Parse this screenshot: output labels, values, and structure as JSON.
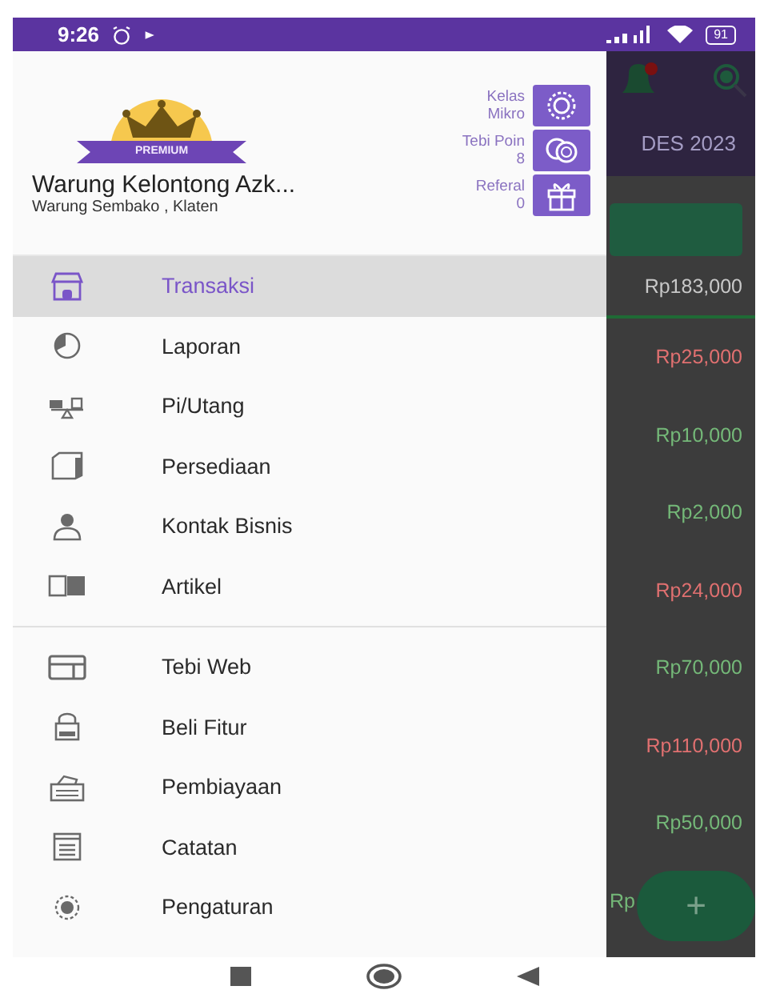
{
  "status_bar": {
    "time": "9:26",
    "battery": "91"
  },
  "drawer": {
    "header": {
      "badge": "PREMIUM",
      "name": "Warung Kelontong Azk...",
      "subtitle": "Warung Sembako , Klaten",
      "stats": [
        {
          "kind": "class",
          "label": "Kelas",
          "value": "Mikro"
        },
        {
          "kind": "points",
          "label": "Tebi Poin",
          "value": "8"
        },
        {
          "kind": "referral",
          "label": "Referal",
          "value": "0"
        }
      ]
    },
    "sections": [
      [
        {
          "label": "Transaksi",
          "selected": true
        },
        {
          "label": "Laporan",
          "selected": false
        },
        {
          "label": "Pi/Utang",
          "selected": false
        },
        {
          "label": "Persediaan",
          "selected": false
        },
        {
          "label": "Kontak Bisnis",
          "selected": false
        },
        {
          "label": "Artikel",
          "selected": false
        }
      ],
      [
        {
          "label": "Tebi Web",
          "selected": false
        },
        {
          "label": "Beli Fitur",
          "selected": false
        },
        {
          "label": "Pembiayaan",
          "selected": false
        },
        {
          "label": "Catatan",
          "selected": false
        },
        {
          "label": "Pengaturan",
          "selected": false
        }
      ]
    ]
  },
  "background": {
    "period": "DES 2023",
    "total": "Rp183,000",
    "amounts": [
      {
        "text": "Rp25,000",
        "kind": "expense"
      },
      {
        "text": "Rp10,000",
        "kind": "income"
      },
      {
        "text": "Rp2,000",
        "kind": "income"
      },
      {
        "text": "Rp24,000",
        "kind": "expense"
      },
      {
        "text": "Rp70,000",
        "kind": "income"
      },
      {
        "text": "Rp110,000",
        "kind": "expense"
      },
      {
        "text": "Rp50,000",
        "kind": "income"
      },
      {
        "text": "Rp",
        "kind": "income"
      }
    ],
    "fab": "+"
  }
}
